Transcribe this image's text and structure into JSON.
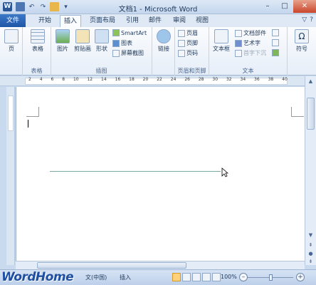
{
  "title": "文档1 - Microsoft Word",
  "app_icon": "W",
  "qat": [
    "save-icon",
    "undo-icon",
    "redo-icon",
    "open-folder-icon",
    "customize-icon"
  ],
  "window_controls": {
    "minimize": "–",
    "maximize": "□",
    "close": "✕"
  },
  "tabs": [
    {
      "label": "文件",
      "key": "file"
    },
    {
      "label": "开始",
      "key": "home"
    },
    {
      "label": "插入",
      "key": "insert"
    },
    {
      "label": "页面布局",
      "key": "layout"
    },
    {
      "label": "引用",
      "key": "references"
    },
    {
      "label": "邮件",
      "key": "mailings"
    },
    {
      "label": "审阅",
      "key": "review"
    },
    {
      "label": "视图",
      "key": "view"
    }
  ],
  "tabs_right": {
    "collapse": "▽",
    "help": "?"
  },
  "ribbon": {
    "page": {
      "label": "页"
    },
    "tables": {
      "button": "表格",
      "group": "表格"
    },
    "illustrations": {
      "picture": "图片",
      "clipart": "剪贴画",
      "shapes": "形状",
      "smartart": "SmartArt",
      "chart": "图表",
      "screenshot": "屏幕截图",
      "group": "插图"
    },
    "links": {
      "button": "链接"
    },
    "header_footer": {
      "header": "页眉",
      "footer": "页脚",
      "page_number": "页码",
      "group": "页眉和页脚"
    },
    "text": {
      "textbox": "文本框",
      "quickparts": "文档部件",
      "wordart": "艺术字",
      "dropcap": "首字下沉",
      "group": "文本"
    },
    "symbols": {
      "button": "符号"
    }
  },
  "ruler_numbers": [
    "2",
    "4",
    "6",
    "8",
    "10",
    "12",
    "14",
    "16",
    "18",
    "20",
    "22",
    "24",
    "26",
    "28",
    "30",
    "32",
    "34",
    "36",
    "38",
    "40"
  ],
  "status": {
    "watermark": "WordHome",
    "language": "文(中国)",
    "insert_mode": "插入",
    "zoom": "100%"
  }
}
